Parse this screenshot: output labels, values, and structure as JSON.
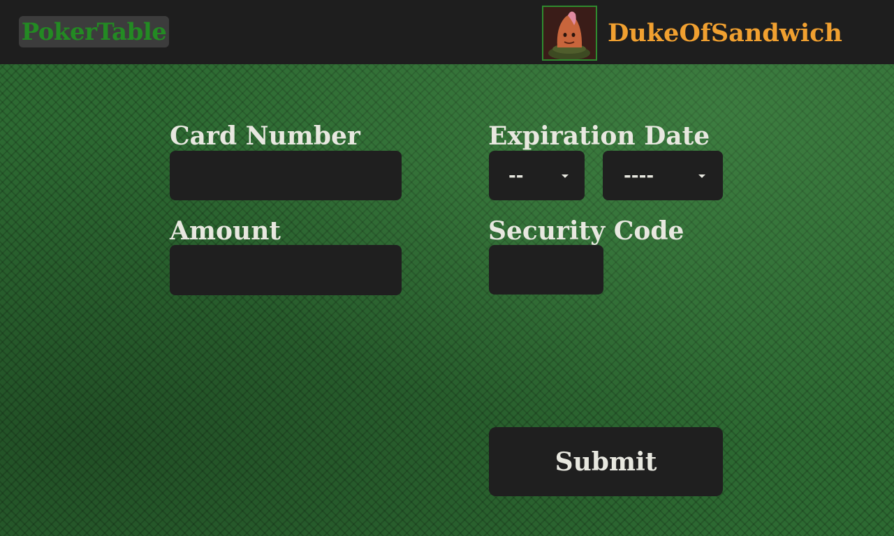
{
  "header": {
    "brand": "PokerTable",
    "username": "DukeOfSandwich",
    "avatar_icon": "ham-character-avatar"
  },
  "form": {
    "card_number": {
      "label": "Card Number",
      "value": "",
      "placeholder": ""
    },
    "expiration": {
      "label": "Expiration Date",
      "month": {
        "selected": "--"
      },
      "year": {
        "selected": "----"
      }
    },
    "amount": {
      "label": "Amount",
      "value": "",
      "placeholder": ""
    },
    "security_code": {
      "label": "Security Code",
      "value": "",
      "placeholder": ""
    },
    "submit_label": "Submit"
  },
  "colors": {
    "header_bg": "#1e1e1e",
    "brand_text": "#238a23",
    "username_text": "#f0a030",
    "felt_green": "#2d6a32",
    "field_bg": "#1f1f1f",
    "label_text": "#e8e8e0",
    "avatar_border": "#2f8b2f"
  }
}
